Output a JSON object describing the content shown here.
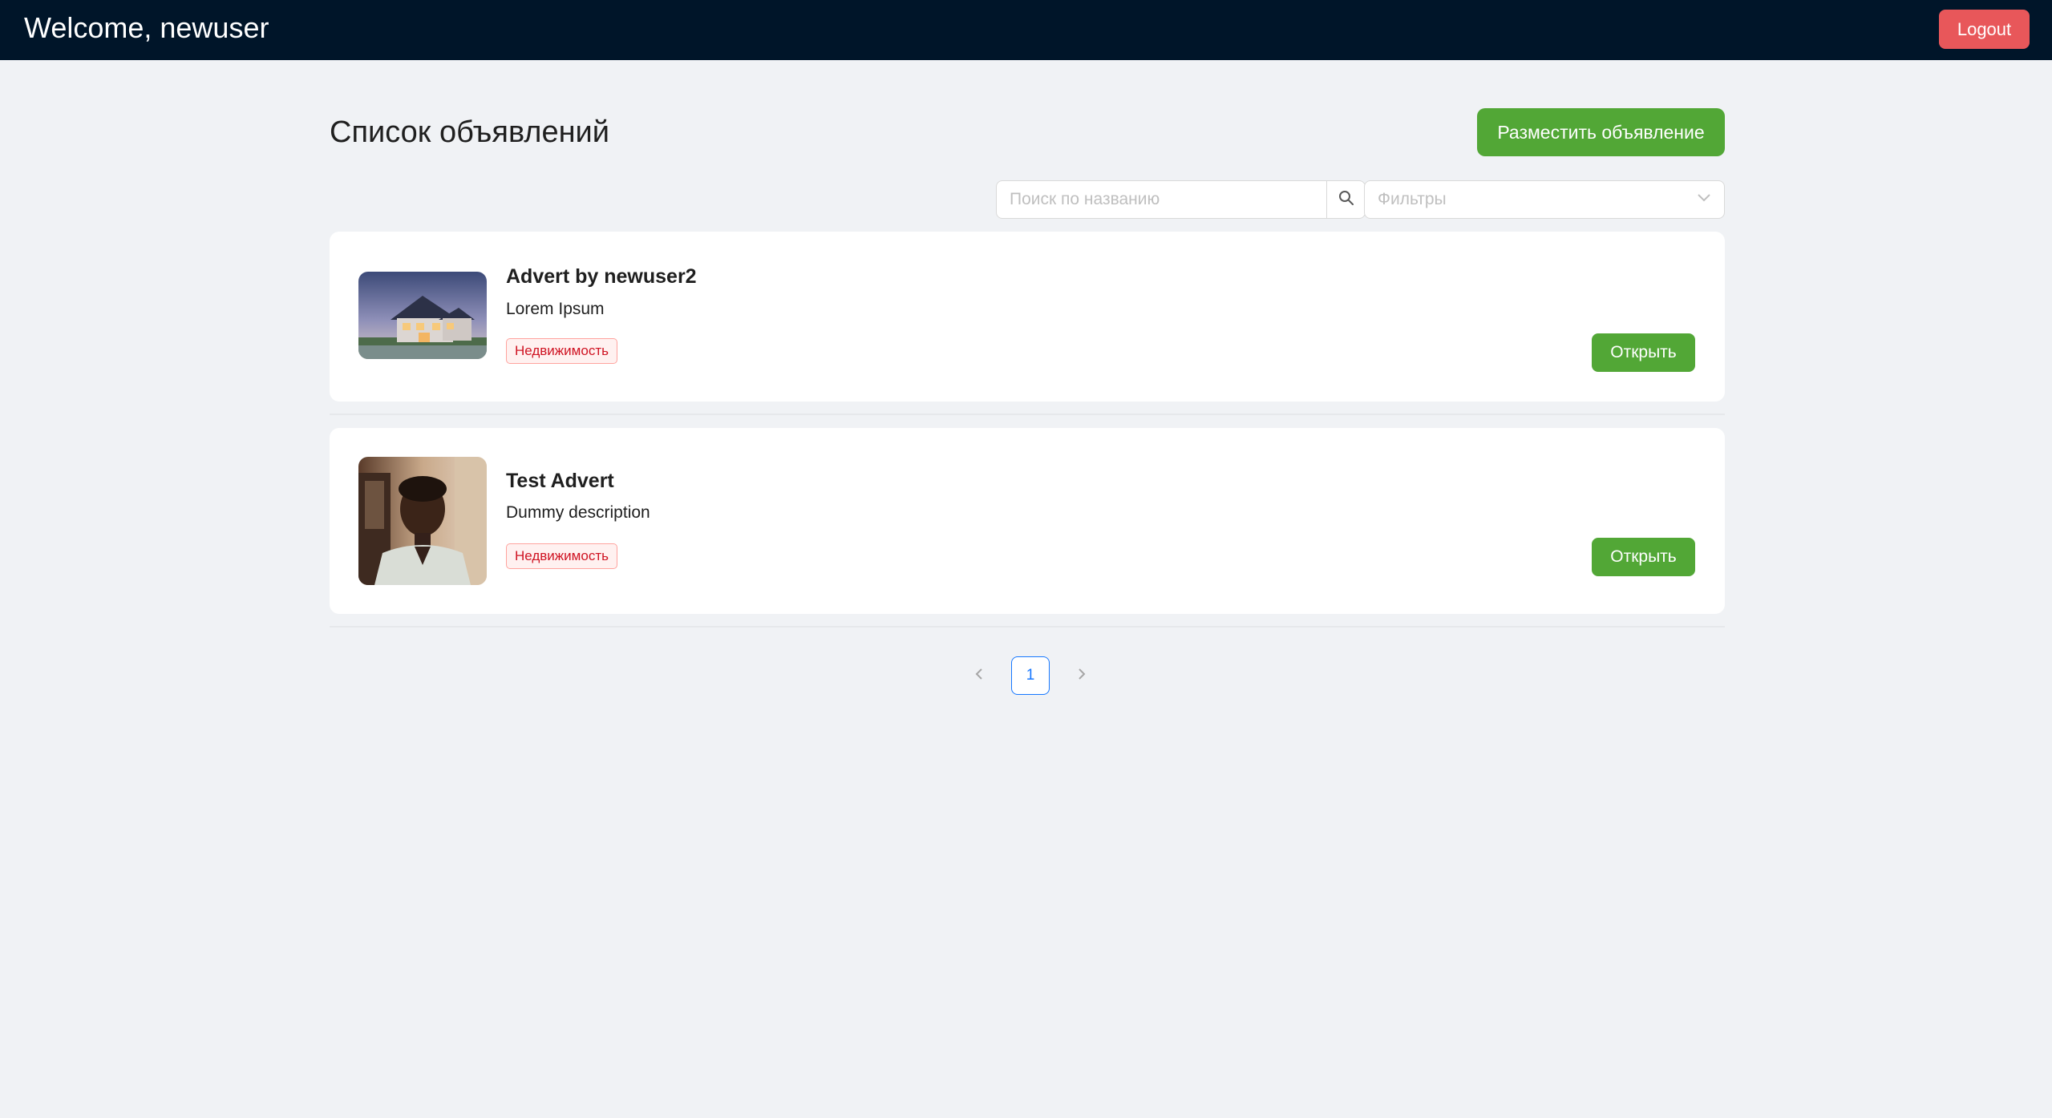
{
  "header": {
    "title": "Welcome, newuser",
    "logout_label": "Logout"
  },
  "main": {
    "title": "Список объявлений",
    "post_button_label": "Разместить объявление",
    "search": {
      "placeholder": "Поиск по названию",
      "value": ""
    },
    "filter": {
      "placeholder": "Фильтры"
    }
  },
  "adverts": [
    {
      "title": "Advert by newuser2",
      "description": "Lorem Ipsum",
      "tag": "Недвижимость",
      "open_label": "Открыть",
      "image": "house-photo"
    },
    {
      "title": "Test Advert",
      "description": "Dummy description",
      "tag": "Недвижимость",
      "open_label": "Открыть",
      "image": "person-photo"
    }
  ],
  "pagination": {
    "current_page": "1"
  },
  "colors": {
    "header_bg": "#001529",
    "logout": "#e8575a",
    "primary_green": "#52a736",
    "tag_red": "#cf1322",
    "page_bg": "#f0f2f5",
    "link_blue": "#1677ff"
  }
}
